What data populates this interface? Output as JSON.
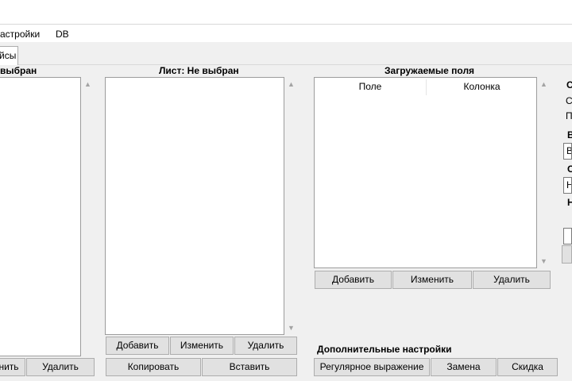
{
  "menu": {
    "settings": "астройки",
    "db": "DB"
  },
  "tabs": {
    "active_label": "йсы"
  },
  "left_panel": {
    "title": "выбран",
    "buttons": {
      "edit": "нить",
      "delete": "Удалить"
    }
  },
  "sheet_panel": {
    "title": "Лист: Не выбран",
    "buttons": {
      "add": "Добавить",
      "edit": "Изменить",
      "delete": "Удалить",
      "copy": "Копировать",
      "paste": "Вставить"
    }
  },
  "fields_panel": {
    "title": "Загружаемые поля",
    "columns": [
      "Поле",
      "Колонка"
    ],
    "buttons": {
      "add": "Добавить",
      "edit": "Изменить",
      "delete": "Удалить"
    }
  },
  "extra_settings": {
    "title": "Дополнительные настройки",
    "buttons": {
      "regex": "Регулярное выражение",
      "replace": "Замена",
      "discount": "Скидка"
    }
  },
  "right_panel": {
    "heading": "С",
    "line1": "С",
    "line2": "П",
    "group1_title": "В",
    "field1_value": "В",
    "group2_title": "С",
    "field2_value": "Н",
    "group3_title": "Н"
  },
  "scroll_arrows": {
    "up": "▲",
    "down": "▼"
  }
}
